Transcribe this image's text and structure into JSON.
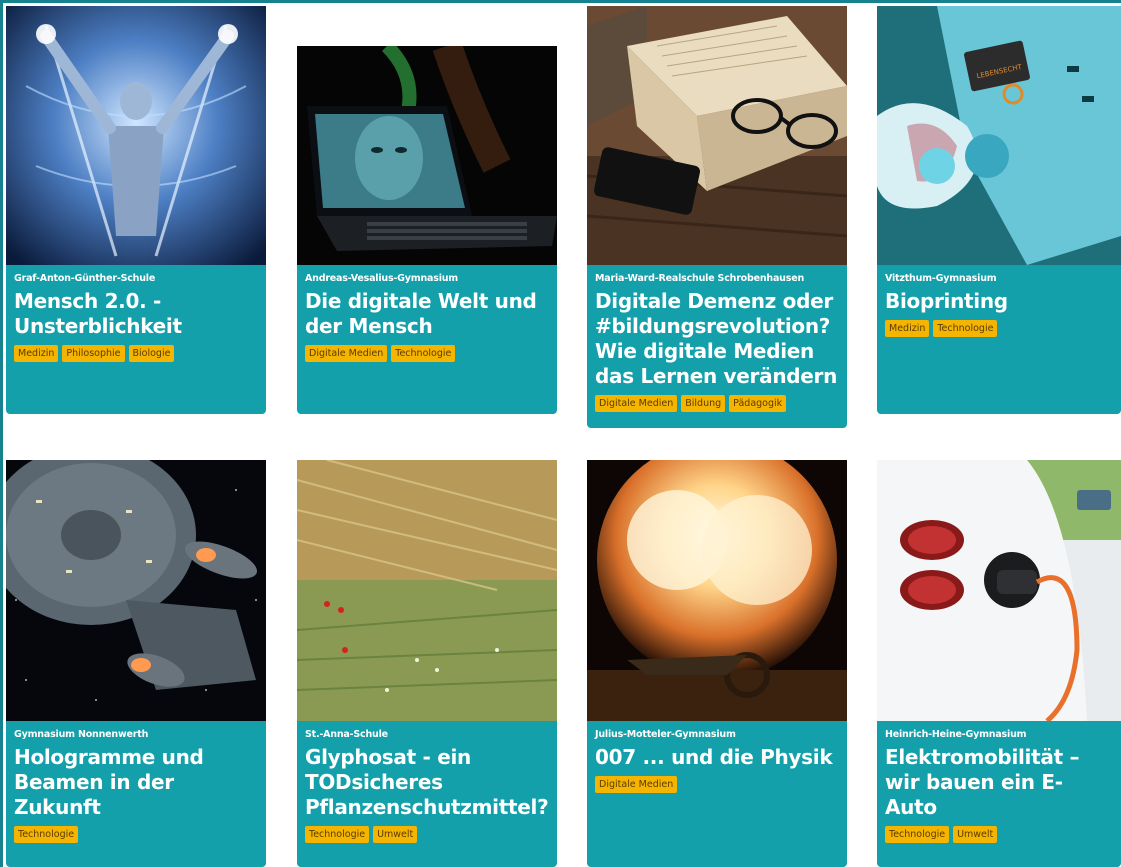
{
  "cards": [
    {
      "school": "Graf-Anton-Günther-Schule",
      "title": "Mensch 2.0. - Unsterblichkeit",
      "tags": [
        "Medizin",
        "Philosophie",
        "Biologie"
      ]
    },
    {
      "school": "Andreas-Vesalius-Gymnasium",
      "title": "Die digitale Welt und der Mensch",
      "tags": [
        "Digitale Medien",
        "Technologie"
      ]
    },
    {
      "school": "Maria-Ward-Realschule Schrobenhausen",
      "title": "Digitale Demenz oder #bildungsrevolution? Wie digitale Medien das Lernen verändern",
      "tags": [
        "Digitale Medien",
        "Bildung",
        "Pädagogik"
      ]
    },
    {
      "school": "Vitzthum-Gymnasium",
      "title": "Bioprinting",
      "tags": [
        "Medizin",
        "Technologie"
      ],
      "image_text": "LEBENSECHT"
    },
    {
      "school": "Gymnasium Nonnenwerth",
      "title": "Hologramme und Beamen in der Zukunft",
      "tags": [
        "Technologie"
      ]
    },
    {
      "school": "St.-Anna-Schule",
      "title": "Glyphosat - ein TODsicheres Pflanzenschutzmittel?",
      "tags": [
        "Technologie",
        "Umwelt"
      ]
    },
    {
      "school": "Julius-Motteler-Gymnasium",
      "title": "007 ... und die Physik",
      "tags": [
        "Digitale Medien"
      ]
    },
    {
      "school": "Heinrich-Heine-Gymnasium",
      "title": "Elektromobilität – wir bauen ein E-Auto",
      "tags": [
        "Technologie",
        "Umwelt"
      ]
    }
  ],
  "colors": {
    "card": "#14a0aa",
    "tag": "#f4b400",
    "frame": "#16828d"
  }
}
